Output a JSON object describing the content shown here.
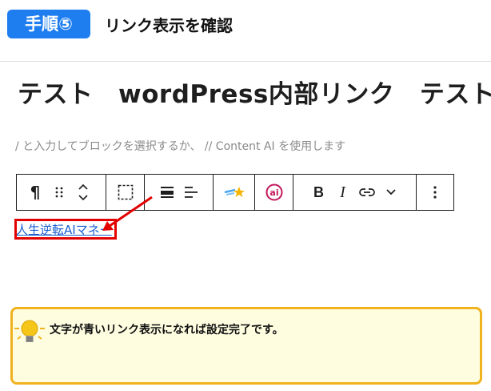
{
  "step": {
    "badge": "手順⑤",
    "title": "リンク表示を確認"
  },
  "editor": {
    "post_title": "テスト　wordPress内部リンク　テスト",
    "placeholder": "/ と入力してブロックを選択するか、 // Content AI を使用します"
  },
  "toolbar": {
    "buttons": [
      {
        "name": "paragraph",
        "glyph": "¶"
      },
      {
        "name": "drag",
        "glyph": "⠿"
      },
      {
        "name": "move",
        "glyph": "⌃⌄"
      },
      {
        "name": "select-parent",
        "glyph": "⬚"
      },
      {
        "name": "align-text",
        "glyph": "≡"
      },
      {
        "name": "align-left",
        "glyph": "≡"
      },
      {
        "name": "ai-star",
        "glyph": "★"
      },
      {
        "name": "ai-assistant",
        "glyph": "@"
      },
      {
        "name": "bold",
        "glyph": "B"
      },
      {
        "name": "italic",
        "glyph": "I"
      },
      {
        "name": "link",
        "glyph": "⊂⊃"
      },
      {
        "name": "more-rich-text",
        "glyph": "⌄"
      },
      {
        "name": "options",
        "glyph": "⋮"
      }
    ]
  },
  "link": {
    "text": "人生逆転AIマネー"
  },
  "tip": {
    "text": "文字が青いリンク表示になれば設定完了です。"
  },
  "colors": {
    "badge": "#1e7ef0",
    "highlight": "#e30000",
    "link": "#1a5fd1",
    "tip_border": "#f0b21e",
    "tip_bg": "#fffde0"
  }
}
